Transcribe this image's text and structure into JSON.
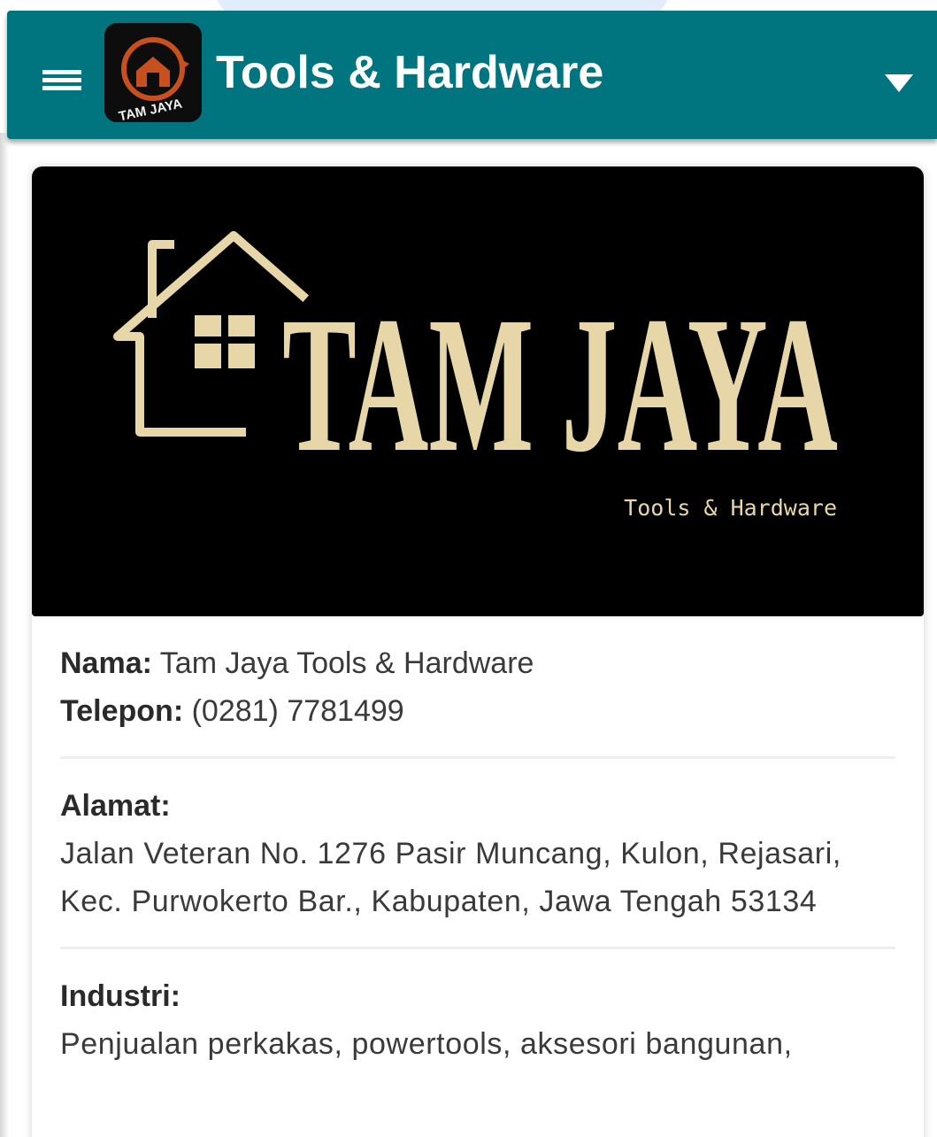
{
  "app_bar": {
    "title": "Tools & Hardware",
    "logo_text": "TAM JAYA",
    "background_color": "#00757f",
    "menu_icon": "hamburger-menu-icon",
    "dropdown_icon": "caret-down-icon"
  },
  "banner": {
    "brand_name": "TAM JAYA",
    "tagline": "Tools & Hardware",
    "background_color": "#000000",
    "brand_color": "#e7d7a8"
  },
  "details": {
    "name_label": "Nama:",
    "name_value": "Tam Jaya Tools & Hardware",
    "phone_label": "Telepon:",
    "phone_value": "(0281) 7781499",
    "address_label": "Alamat:",
    "address_value": "Jalan Veteran No. 1276 Pasir Muncang, Kulon, Rejasari, Kec. Purwokerto Bar., Kabupaten, Jawa Tengah 53134",
    "industry_label": "Industri:",
    "industry_value": "Penjualan perkakas, powertools, aksesori bangunan,"
  }
}
